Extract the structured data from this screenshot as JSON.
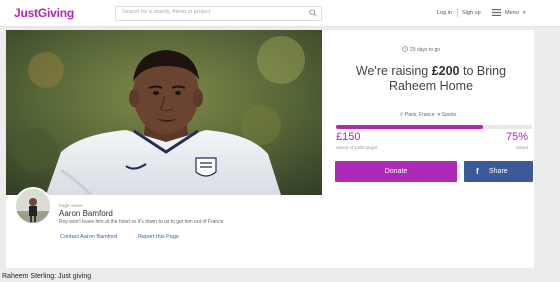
{
  "header": {
    "logo": "JustGiving",
    "search_placeholder": "Search for a charity, friend or project",
    "login": "Log in",
    "signup": "Sign up",
    "menu": "Menu",
    "brand_color": "#ad29b6"
  },
  "campaign": {
    "days_left": "29 days to go",
    "headline_pre": "We're raising ",
    "headline_amount": "£200",
    "headline_post": " to Bring Raheem Home",
    "location": "Paris, France",
    "category": "Sports",
    "progress_fraction": 0.75,
    "raised": "£150",
    "raised_sub": "raised of £200 target",
    "percent": "75%",
    "percent_sub": "raised",
    "donate_label": "Donate",
    "share_label": "Share"
  },
  "owner": {
    "kicker": "Page owner",
    "name": "Aaron Bamford",
    "description": "Roy won't leave him at the hotel so it's down to us to get him out of France",
    "contact_link": "Contact Aaron Bamford",
    "report_link": "Report this Page"
  },
  "caption": "Raheem Sterling: Just giving"
}
